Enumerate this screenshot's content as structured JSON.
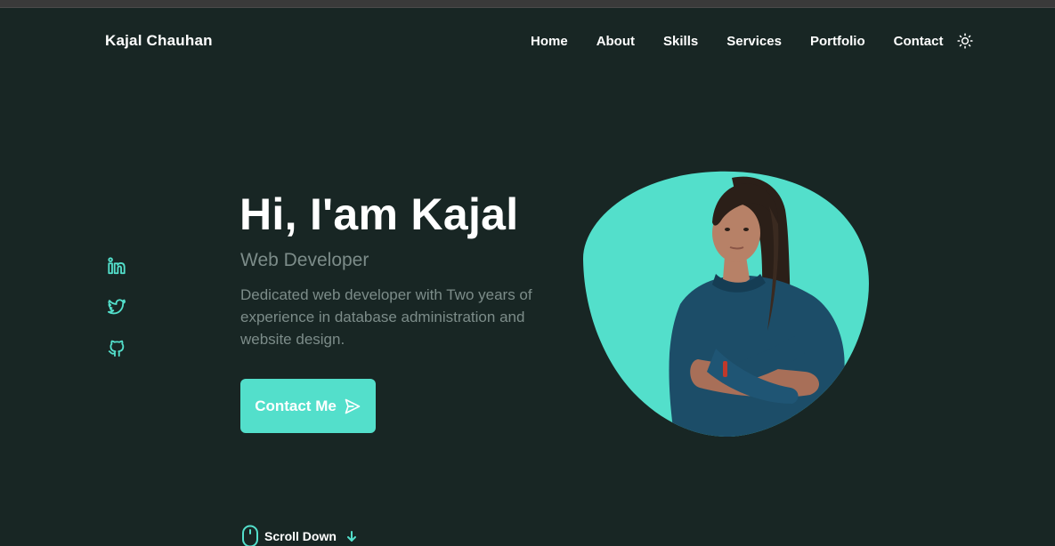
{
  "colors": {
    "background": "#182624",
    "accent": "#53dfcb",
    "muted_text": "#7c8c89",
    "text": "#ffffff"
  },
  "header": {
    "logo": "Kajal Chauhan",
    "nav": [
      "Home",
      "About",
      "Skills",
      "Services",
      "Portfolio",
      "Contact"
    ],
    "theme_toggle_icon": "sun-icon"
  },
  "socials": [
    {
      "icon": "linkedin-icon"
    },
    {
      "icon": "twitter-icon"
    },
    {
      "icon": "github-icon"
    }
  ],
  "hero": {
    "title": "Hi, I'am Kajal",
    "subtitle": "Web Developer",
    "description": "Dedicated web developer with Two years of experience in database administration and website design.",
    "cta_label": "Contact Me",
    "cta_icon": "send-icon",
    "image": "profile-photo-in-blob"
  },
  "scroll": {
    "label": "Scroll Down",
    "icons": [
      "mouse-icon",
      "arrow-down-icon"
    ]
  }
}
